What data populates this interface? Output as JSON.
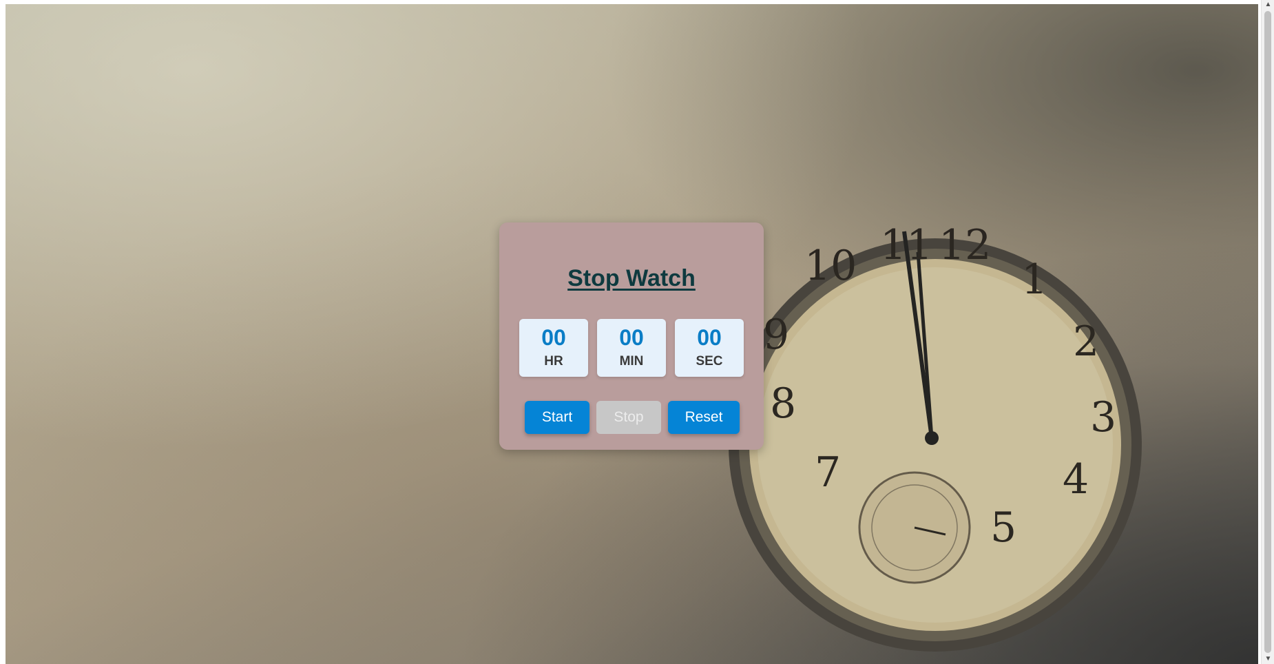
{
  "stopwatch": {
    "title": "Stop Watch",
    "units": [
      {
        "value": "00",
        "label": "HR"
      },
      {
        "value": "00",
        "label": "MIN"
      },
      {
        "value": "00",
        "label": "SEC"
      }
    ],
    "buttons": {
      "start": "Start",
      "stop": "Stop",
      "reset": "Reset"
    }
  },
  "clock_numerals": [
    "11",
    "12",
    "1",
    "2",
    "3",
    "4",
    "5",
    "7",
    "8",
    "9",
    "10"
  ],
  "colors": {
    "card": "#b99d9c",
    "title": "#0e3a3f",
    "digit": "#0a7dc6",
    "button": "#0584d6",
    "button_disabled": "#c7c7c7"
  },
  "icons": {
    "scroll_up": "scroll-up-arrow-icon",
    "scroll_down": "scroll-down-arrow-icon"
  }
}
